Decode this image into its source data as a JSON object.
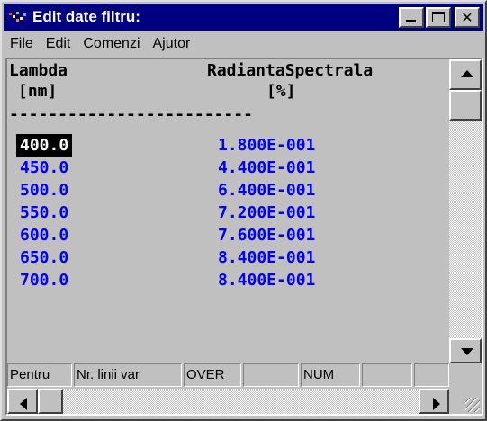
{
  "window": {
    "title": "Edit date filtru:"
  },
  "menu": {
    "items": [
      "File",
      "Edit",
      "Comenzi",
      "Ajutor"
    ]
  },
  "table": {
    "col1_header": "Lambda",
    "col1_unit": "[nm]",
    "col2_header": "RadiantaSpectrala",
    "col2_unit": "[%]",
    "separator": "-------------------------",
    "rows": [
      {
        "lambda": "400.0",
        "value": "1.800E-001"
      },
      {
        "lambda": "450.0",
        "value": "4.400E-001"
      },
      {
        "lambda": "500.0",
        "value": "6.400E-001"
      },
      {
        "lambda": "550.0",
        "value": "7.200E-001"
      },
      {
        "lambda": "600.0",
        "value": "7.600E-001"
      },
      {
        "lambda": "650.0",
        "value": "8.400E-001"
      },
      {
        "lambda": "700.0",
        "value": "8.400E-001"
      }
    ],
    "selected_row": 0
  },
  "statusbar": {
    "panels": [
      "Pentru",
      "Nr. linii var",
      "OVER",
      "",
      "NUM",
      "",
      ""
    ]
  },
  "colors": {
    "title_bg": "#000080",
    "data_text": "#0000ff",
    "selection_bg": "#000000",
    "window_bg": "#c0c0c0"
  }
}
